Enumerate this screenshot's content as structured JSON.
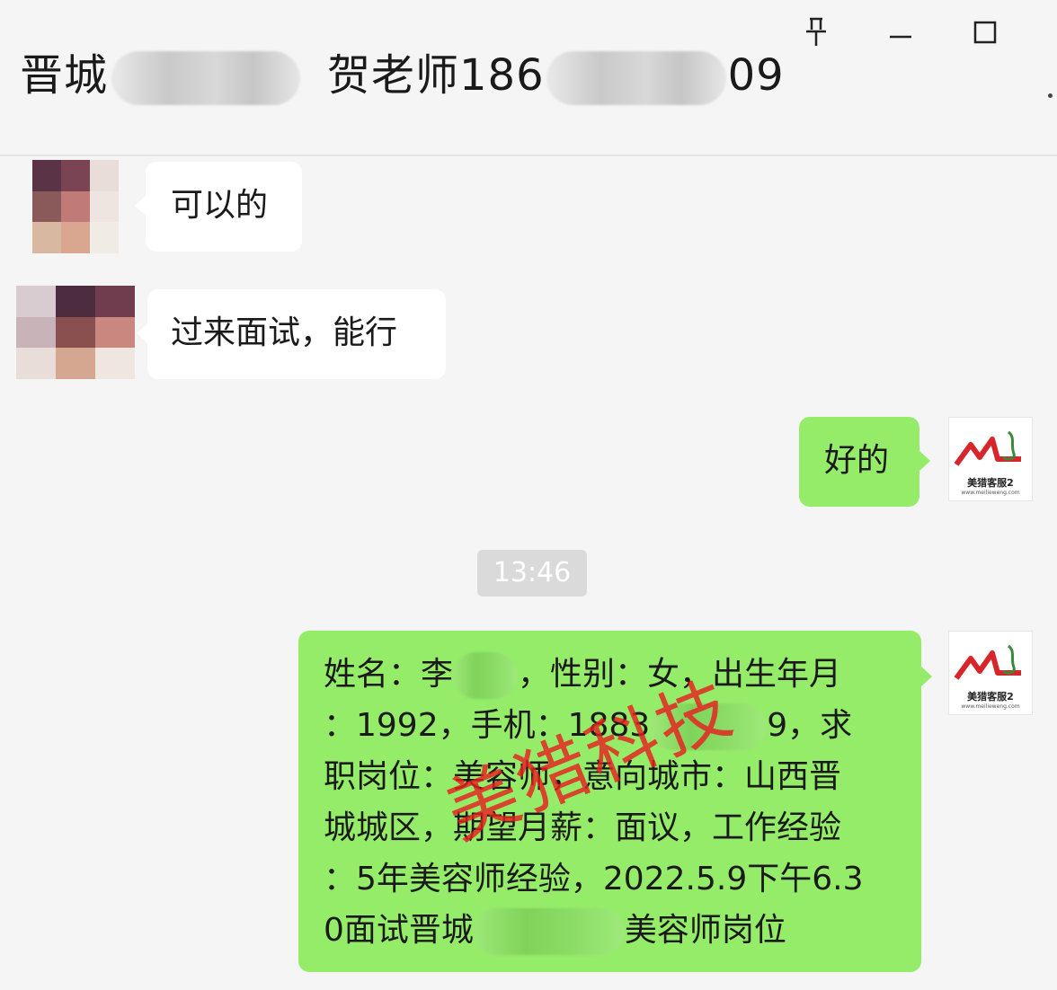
{
  "header": {
    "title_left": "晋城",
    "title_middle": "贺老师186",
    "title_end": "09",
    "pin_icon": "pin-icon",
    "minimize_icon": "minimize-icon",
    "maximize_icon": "maximize-icon"
  },
  "messages": [
    {
      "direction": "incoming",
      "text": "可以的"
    },
    {
      "direction": "incoming",
      "text": "过来面试，能行"
    },
    {
      "direction": "outgoing",
      "text": "好的"
    },
    {
      "direction": "timestamp",
      "text": "13:46"
    },
    {
      "direction": "outgoing",
      "lines": [
        {
          "before": "姓名：李",
          "after": "，性别：女，出生年月"
        },
        {
          "before": "：1992，手机：1883",
          "after": "9，求"
        },
        {
          "text": "职岗位：美容师，意向城市：山西晋"
        },
        {
          "text": "城城区，期望月薪：面议，工作经验"
        },
        {
          "text": "：5年美容师经验，2022.5.9下午6.3"
        },
        {
          "before": "0面试晋城",
          "after": "美容师岗位"
        }
      ]
    }
  ],
  "my_avatar": {
    "brand": "美猎客服2",
    "url": "www.meilieweng.com"
  },
  "watermark": "美猎科技",
  "colors": {
    "background": "#f5f5f5",
    "incoming_bubble": "#ffffff",
    "outgoing_bubble": "#95ec69",
    "watermark": "#e81e1e",
    "timestamp_bg": "#dadada"
  }
}
